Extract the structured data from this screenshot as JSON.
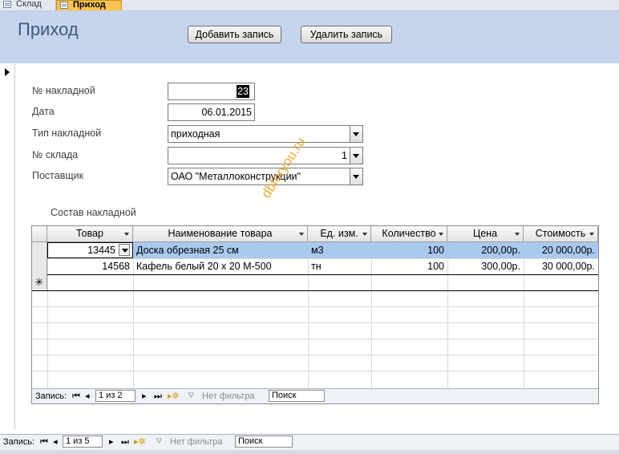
{
  "tabs": [
    {
      "label": "Склад",
      "icon": "form-icon",
      "active": false
    },
    {
      "label": "Приход",
      "icon": "form-icon",
      "active": true
    }
  ],
  "header": {
    "title": "Приход",
    "add_button": "Добавить запись",
    "delete_button": "Удалить запись"
  },
  "fields": {
    "invoice_no": {
      "label": "№ накладной",
      "value": "23"
    },
    "date": {
      "label": "Дата",
      "value": "06.01.2015"
    },
    "invoice_type": {
      "label": "Тип накладной",
      "value": "приходная"
    },
    "warehouse_no": {
      "label": "№ склада",
      "value": "1"
    },
    "supplier": {
      "label": "Поставщик",
      "value": "ОАО \"Металлоконструкции\""
    }
  },
  "subform": {
    "title": "Состав накладной",
    "columns": [
      "Товар",
      "Наименование товара",
      "Ед. изм.",
      "Количество",
      "Цена",
      "Стоимость"
    ],
    "rows": [
      {
        "product": "13445",
        "name": "Доска обрезная 25 см",
        "unit": "м3",
        "qty": "100",
        "price": "200,00р.",
        "cost": "20 000,00р."
      },
      {
        "product": "14568",
        "name": "Кафель белый 20 х 20 М-500",
        "unit": "тн",
        "qty": "100",
        "price": "300,00р.",
        "cost": "30 000,00р."
      }
    ],
    "new_row_marker": "✳",
    "nav": {
      "label": "Запись:",
      "position": "1 из 2",
      "filter": "Нет фильтра",
      "search": "Поиск"
    }
  },
  "main_nav": {
    "label": "Запись:",
    "position": "1 из 5",
    "filter": "Нет фильтра",
    "search": "Поиск"
  },
  "watermark": "dbforyou.ru"
}
